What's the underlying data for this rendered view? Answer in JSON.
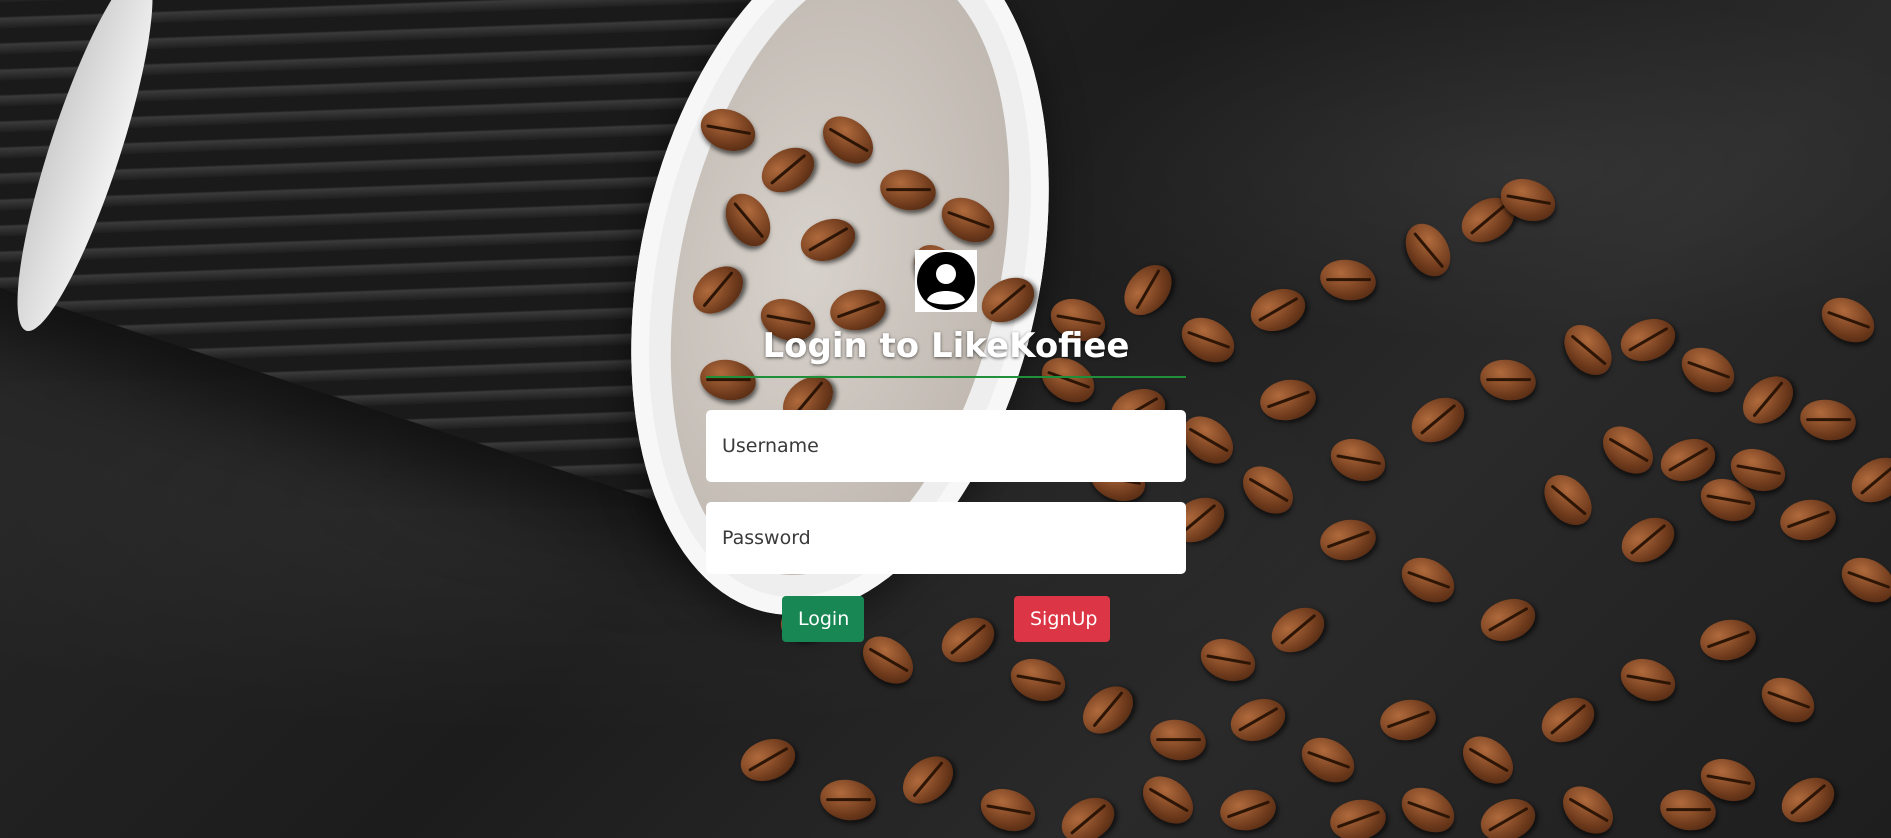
{
  "page": {
    "title": "Login to LikeKofiee"
  },
  "form": {
    "username_placeholder": "Username",
    "username_value": "",
    "password_placeholder": "Password",
    "password_value": "",
    "login_label": "Login",
    "signup_label": "SignUp"
  },
  "icons": {
    "avatar": "user-circle-icon"
  },
  "colors": {
    "divider": "#1f8f3a",
    "login_button": "#198754",
    "signup_button": "#dc3545",
    "title_text": "#ffffff"
  }
}
